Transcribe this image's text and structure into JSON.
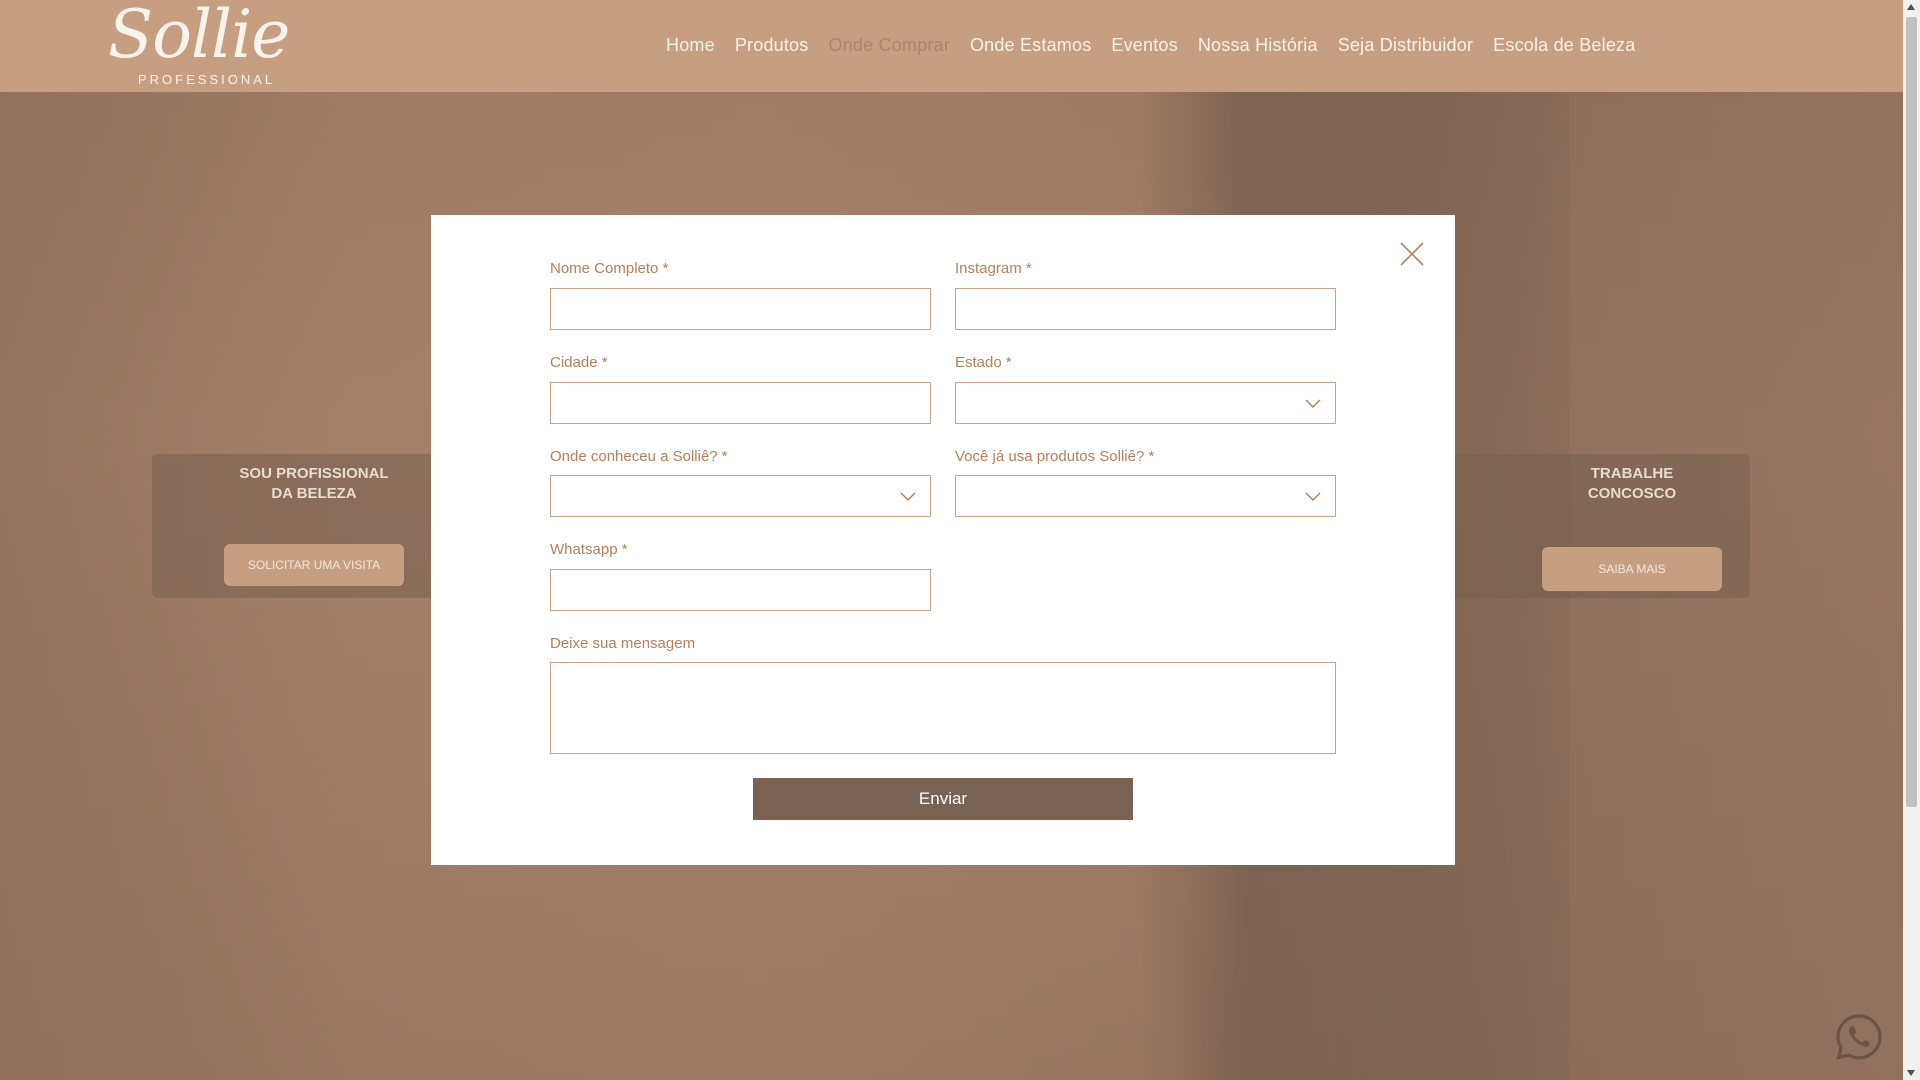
{
  "header": {
    "logo": {
      "script_text": "Sollie",
      "sub_text": "PROFESSIONAL"
    },
    "nav": [
      {
        "label": "Home",
        "active": false
      },
      {
        "label": "Produtos",
        "active": false
      },
      {
        "label": "Onde Comprar",
        "active": true
      },
      {
        "label": "Onde Estamos",
        "active": false
      },
      {
        "label": "Eventos",
        "active": false
      },
      {
        "label": "Nossa História",
        "active": false
      },
      {
        "label": "Seja Distribuidor",
        "active": false
      },
      {
        "label": "Escola de Beleza",
        "active": false
      }
    ]
  },
  "cards": {
    "left": {
      "title_line1": "SOU PROFISSIONAL",
      "title_line2": "DA BELEZA",
      "button": "SOLICITAR UMA VISITA"
    },
    "right": {
      "title_line1": "TRABALHE",
      "title_line2": "CONCOSCO",
      "button": "SAIBA MAIS"
    }
  },
  "form": {
    "nome": {
      "label": "Nome Completo *",
      "value": "",
      "placeholder": ""
    },
    "instagram": {
      "label": "Instagram *",
      "value": "",
      "placeholder": ""
    },
    "cidade": {
      "label": "Cidade *",
      "value": "",
      "placeholder": ""
    },
    "estado": {
      "label": "Estado *",
      "selected": ""
    },
    "conheceu": {
      "label": "Onde conheceu a Solliê? *",
      "selected": ""
    },
    "usa_produtos": {
      "label": "Você já usa produtos Solliê? *",
      "selected": ""
    },
    "whatsapp": {
      "label": "Whatsapp *",
      "value": "",
      "placeholder": ""
    },
    "mensagem": {
      "label": "Deixe sua mensagem",
      "value": "",
      "placeholder": ""
    },
    "submit_label": "Enviar"
  },
  "colors": {
    "header_bg": "#c69f82",
    "label": "#b0805f",
    "field_border": "#c8a28a",
    "submit_bg": "#7a6252",
    "whatsapp": "#6b5446"
  },
  "icons": {
    "close": "close-icon",
    "dropdown": "chevron-down-icon",
    "whatsapp": "whatsapp-icon"
  }
}
